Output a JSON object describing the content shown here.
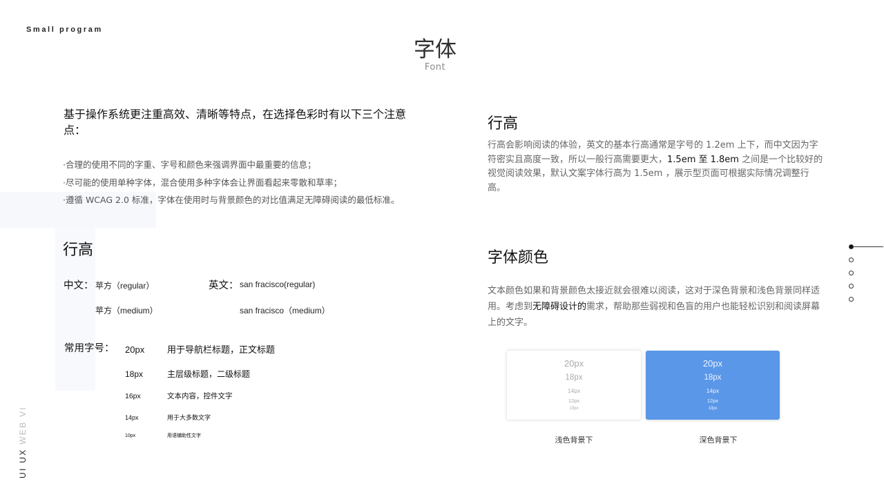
{
  "brand": "Small program",
  "page": {
    "title": "字体",
    "subtitle": "Font"
  },
  "intro": {
    "heading": "基于操作系统更注重高效、清晰等特点，在选择色彩时有以下三个注意点：",
    "bullets": [
      "·合理的使用不同的字重、字号和颜色来强调界面中最重要的信息；",
      "·尽可能的使用单种字体，混合使用多种字体会让界面看起来零散和草率；",
      "·遵循 WCAG 2.0 标准，字体在使用时与背景颜色的对比值满足无障碍阅读的最低标准。"
    ]
  },
  "left_section": {
    "heading": "行高",
    "chinese_label": "中文：",
    "chinese_fonts": [
      "苹方（regular）",
      "苹方（medium）"
    ],
    "english_label": "英文：",
    "english_fonts": [
      "san fracisco(regular)",
      "san fracisco（medium）"
    ],
    "sizes_label": "常用字号：",
    "sizes": [
      {
        "px": "20px",
        "desc": "用于导航栏标题，正文标题"
      },
      {
        "px": "18px",
        "desc": "主层级标题，二级标题"
      },
      {
        "px": "16px",
        "desc": "文本内容，控件文字"
      },
      {
        "px": "14px",
        "desc": "用于大多数文字"
      },
      {
        "px": "10px",
        "desc": "用语辅助性文字"
      }
    ]
  },
  "line_height": {
    "heading": "行高",
    "text_pre": "行高会影响阅读的体验，英文的基本行高通常是字号的 1.2em 上下，而中文因为字符密实且高度一致，所以一般行高需要更大，",
    "text_em": "1.5em 至 1.8em",
    "text_post": " 之间是一个比较好的视觉阅读效果，默认文案字体行高为 1.5em ，展示型页面可根据实际情况调整行高。"
  },
  "font_color": {
    "heading": "字体颜色",
    "text_pre": "文本颜色如果和背景颜色太接近就会很难以阅读，这对于深色背景和浅色背景同样适用。考虑到",
    "text_em": "无障碍设计的",
    "text_post": "需求，帮助那些弱视和色盲的用户也能轻松识别和阅读屏幕上的文字。",
    "samples": [
      "20px",
      "18px",
      "14px",
      "12px",
      "10px"
    ],
    "light_caption": "浅色背景下",
    "dark_caption": "深色背景下",
    "dark_bg": "#5a97e8"
  },
  "side_label": {
    "strong": "UI  UX",
    "light": "  WEB  VI"
  },
  "colors": {
    "accent": "#5a97e8",
    "text": "#111111",
    "muted": "#666666"
  },
  "pagination": {
    "count": 5,
    "active": 1
  }
}
